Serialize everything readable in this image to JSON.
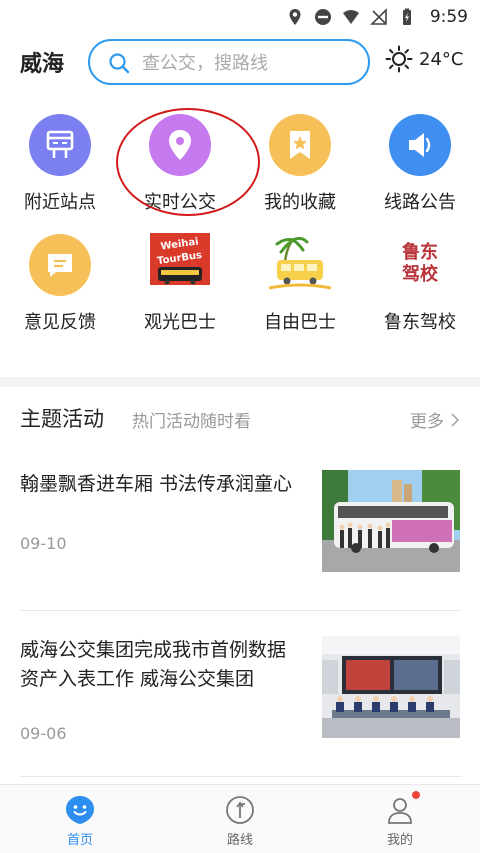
{
  "status_bar": {
    "time": "9:59"
  },
  "header": {
    "city": "威海",
    "search_placeholder": "查公交，搜路线",
    "temperature": "24°C"
  },
  "grid": {
    "items": [
      {
        "label": "附近站点",
        "icon": "bus-stop-icon",
        "color": "#7b7ff0"
      },
      {
        "label": "实时公交",
        "icon": "location-pin-icon",
        "color": "#c67af0"
      },
      {
        "label": "我的收藏",
        "icon": "star-bookmark-icon",
        "color": "#f5c057"
      },
      {
        "label": "线路公告",
        "icon": "megaphone-icon",
        "color": "#3f8ff0"
      },
      {
        "label": "意见反馈",
        "icon": "message-icon",
        "color": "#f5c057"
      },
      {
        "label": "观光巴士",
        "icon": "tour-bus-logo",
        "logo_text": "Weihai Tour Bus"
      },
      {
        "label": "自由巴士",
        "icon": "free-bus-logo"
      },
      {
        "label": "鲁东驾校",
        "icon": "driving-school-logo",
        "logo_text_line1": "鲁东",
        "logo_text_line2": "驾校",
        "color": "#b8333a"
      }
    ]
  },
  "section": {
    "title": "主题活动",
    "subtitle": "热门活动随时看",
    "more": "更多"
  },
  "news": [
    {
      "title": "翰墨飘香进车厢 书法传承润童心",
      "date": "09-10"
    },
    {
      "title": "威海公交集团完成我市首例数据资产入表工作 威海公交集团",
      "date": "09-06"
    }
  ],
  "bottom_nav": {
    "items": [
      {
        "label": "首页",
        "active": true
      },
      {
        "label": "路线",
        "active": false
      },
      {
        "label": "我的",
        "active": false
      }
    ]
  },
  "colors": {
    "accent": "#2e8ef0",
    "highlight": "#d21a1a",
    "badge": "#e9473c"
  }
}
